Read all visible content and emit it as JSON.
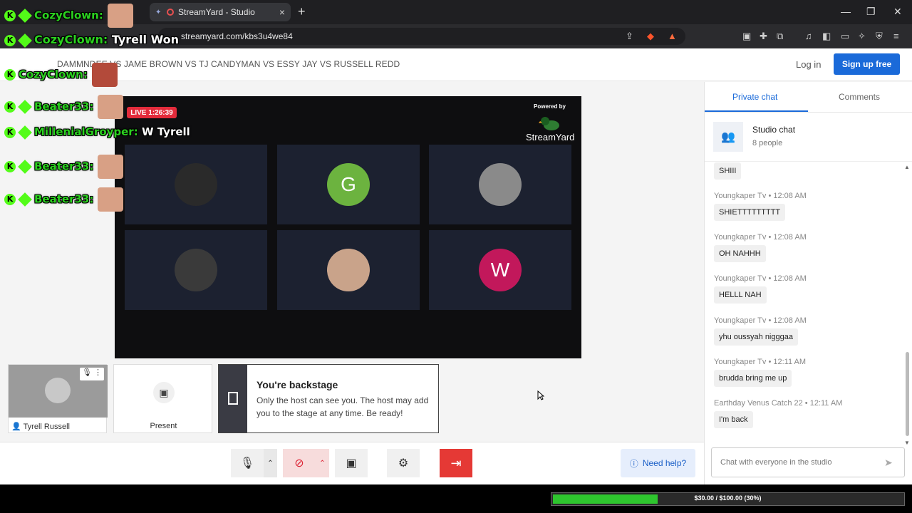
{
  "browser": {
    "tab_title": "StreamYard - Studio",
    "url": "streamyard.com/kbs3u4we84",
    "new_tab": "+",
    "tab_close": "×",
    "win_min": "—",
    "win_max": "❐",
    "win_close": "✕"
  },
  "header": {
    "title": "DAMMNDEE VS JAME BROWN VS TJ CANDYMAN VS ESSY JAY VS RUSSELL REDD",
    "login": "Log in",
    "signup": "Sign up free"
  },
  "stage": {
    "live": "LIVE 1:26:39",
    "powered_by": "Powered by",
    "brand": "StreamYard",
    "tiles": [
      {
        "initial": "",
        "color": "#2a2a2a"
      },
      {
        "initial": "G",
        "color": "#6cb33f"
      },
      {
        "initial": "",
        "color": "#8a8a8a"
      },
      {
        "initial": "",
        "color": "#3a3a3a"
      },
      {
        "initial": "",
        "color": "#c9a38a"
      },
      {
        "initial": "W",
        "color": "#c2185b"
      }
    ]
  },
  "overlay": [
    {
      "user": "CozyClown:",
      "text": ""
    },
    {
      "user": "CozyClown:",
      "text": "Tyrell Won"
    },
    {
      "user": "CozyClown:",
      "text": ""
    },
    {
      "user": "Beater33:",
      "text": ""
    },
    {
      "user": "MillenialGroyper:",
      "text": "W Tyrell"
    },
    {
      "user": "Beater33:",
      "text": ""
    },
    {
      "user": "Beater33:",
      "text": ""
    }
  ],
  "participants": {
    "self_name": "Tyrell Russell",
    "present": "Present"
  },
  "backstage": {
    "title": "You're backstage",
    "body": "Only the host can see you. The host may add you to the stage at any time. Be ready!"
  },
  "controls": {
    "help": "Need help?"
  },
  "sidebar": {
    "tabs": [
      "Private chat",
      "Comments"
    ],
    "chat_title": "Studio chat",
    "chat_sub": "8 people",
    "first_msg": "SHIII",
    "messages": [
      {
        "author": "Youngkaper Tv",
        "time": "12:08 AM",
        "text": "SHIETTTTTTTTT"
      },
      {
        "author": "Youngkaper Tv",
        "time": "12:08 AM",
        "text": "OH NAHHH"
      },
      {
        "author": "Youngkaper Tv",
        "time": "12:08 AM",
        "text": "HELLL NAH"
      },
      {
        "author": "Youngkaper Tv",
        "time": "12:08 AM",
        "text": "yhu oussyah nigggaa"
      },
      {
        "author": "Youngkaper Tv",
        "time": "12:11 AM",
        "text": "brudda bring me up"
      },
      {
        "author": "Earthday Venus Catch 22",
        "time": "12:11 AM",
        "text": "I'm back"
      }
    ],
    "input_placeholder": "Chat with everyone in the studio"
  },
  "goal": {
    "label": "$30.00 / $100.00 (30%)",
    "progress": 0.3
  },
  "colors": {
    "accent": "#1a6ad9",
    "live": "#e32b3b",
    "overlay_name": "#2bd11f"
  }
}
